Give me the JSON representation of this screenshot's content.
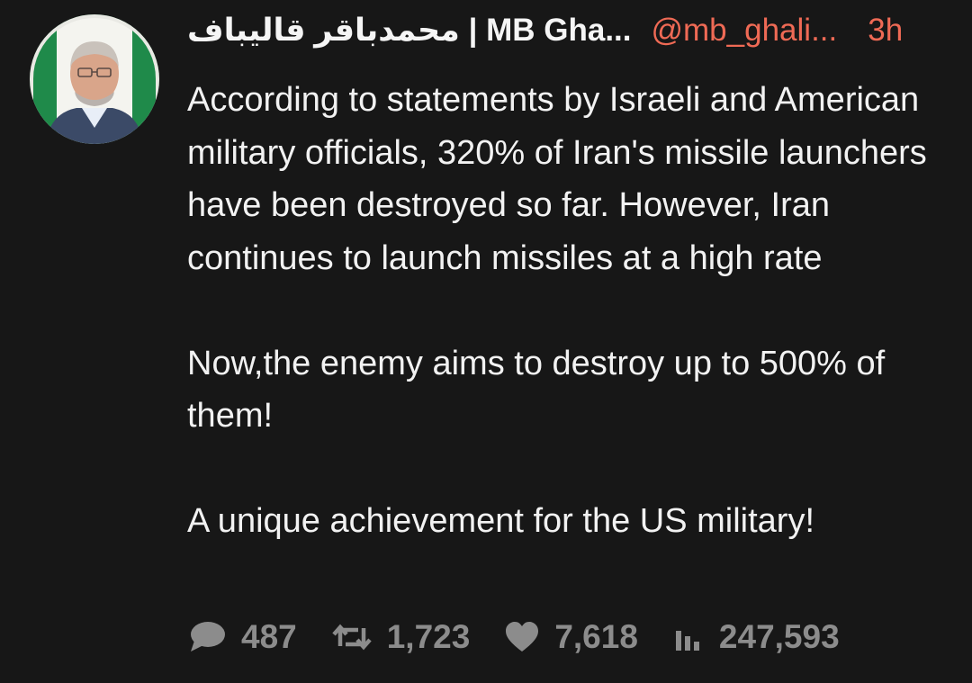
{
  "tweet": {
    "author_name": "محمدباقر قالیباف | MB Gha...",
    "handle": "@mb_ghali...",
    "time": "3h",
    "paragraphs": [
      "According to statements by Israeli and American military officials, 320% of Iran's missile launchers have been destroyed so far. However, Iran continues to launch missiles at a high rate",
      "Now,the enemy aims to destroy up to 500% of them!",
      "A unique achievement for the US military!"
    ]
  },
  "stats": {
    "replies": "487",
    "retweets": "1,723",
    "likes": "7,618",
    "views": "247,593"
  },
  "icons": {
    "reply": "comment-bubble-icon",
    "retweet": "retweet-icon",
    "like": "heart-icon",
    "views": "bar-chart-icon"
  },
  "colors": {
    "background": "#171717",
    "accent": "#ef6a55",
    "muted": "#8c8c8c"
  }
}
